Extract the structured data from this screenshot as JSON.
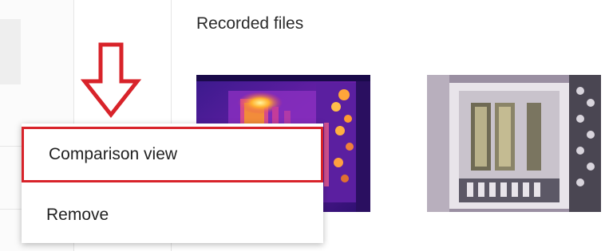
{
  "panel": {
    "title": "Recorded files"
  },
  "recorded_files": [
    {
      "type": "thermal",
      "icon": "thermal-image-thumbnail"
    },
    {
      "type": "visual",
      "icon": "visual-image-thumbnail"
    }
  ],
  "context_menu": {
    "items": [
      {
        "label": "Comparison view",
        "highlighted": true
      },
      {
        "label": "Remove",
        "highlighted": false
      }
    ]
  },
  "annotation": {
    "arrow_color": "#d8232a",
    "highlight_color": "#d8232a"
  }
}
